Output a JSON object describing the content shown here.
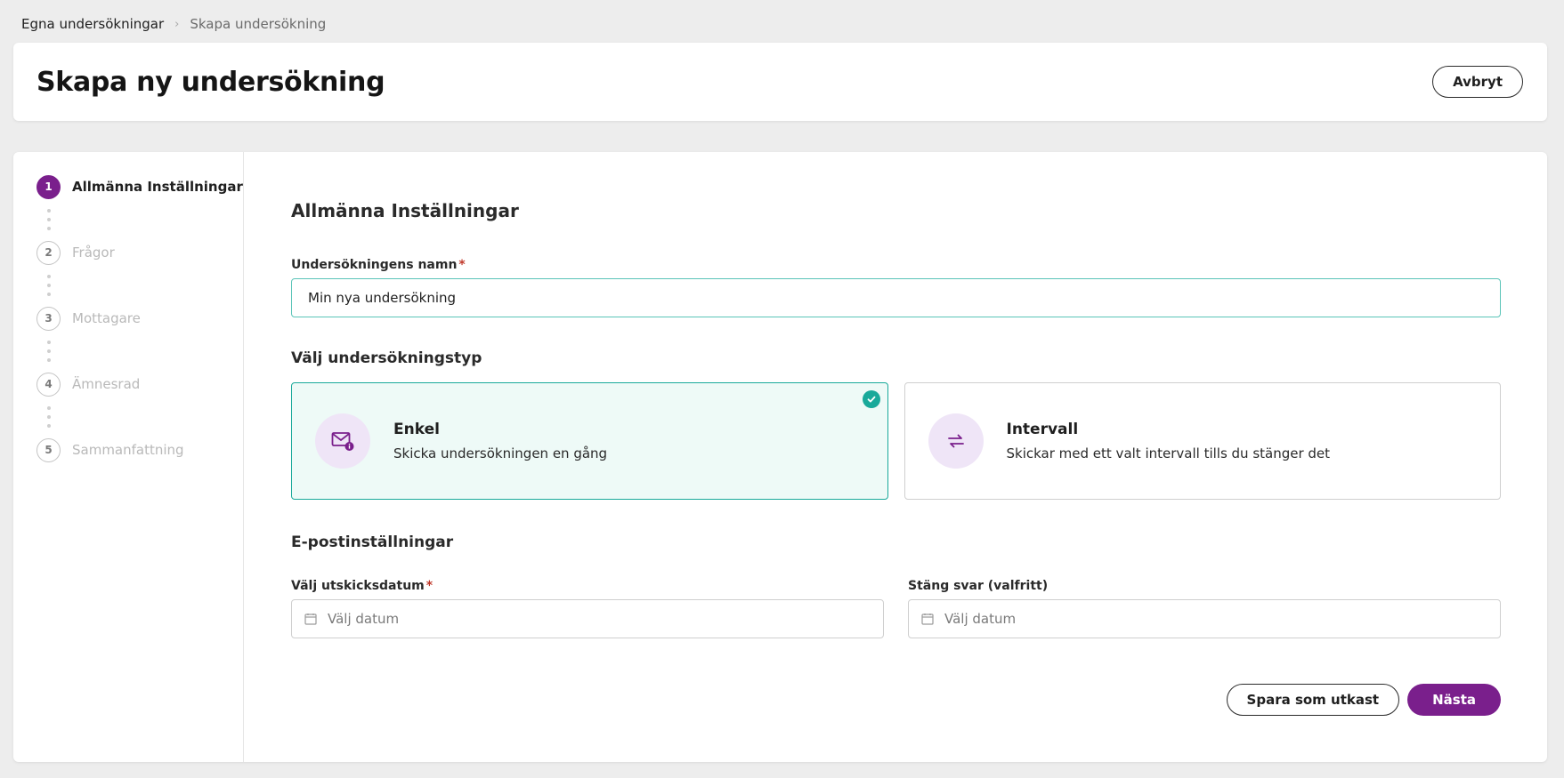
{
  "breadcrumb": {
    "parent": "Egna undersökningar",
    "separator": "›",
    "current": "Skapa undersökning"
  },
  "header": {
    "title": "Skapa ny undersökning",
    "cancel_label": "Avbryt"
  },
  "stepper": {
    "steps": [
      {
        "num": "1",
        "label": "Allmänna Inställningar",
        "active": true
      },
      {
        "num": "2",
        "label": "Frågor",
        "active": false
      },
      {
        "num": "3",
        "label": "Mottagare",
        "active": false
      },
      {
        "num": "4",
        "label": "Ämnesrad",
        "active": false
      },
      {
        "num": "5",
        "label": "Sammanfattning",
        "active": false
      }
    ]
  },
  "form": {
    "section_title": "Allmänna Inställningar",
    "name_label": "Undersökningens namn",
    "required_mark": "*",
    "name_value": "Min nya undersökning",
    "type_title": "Välj undersökningstyp",
    "types": [
      {
        "title": "Enkel",
        "desc": "Skicka undersökningen en gång",
        "icon": "mail-icon",
        "selected": true
      },
      {
        "title": "Intervall",
        "desc": "Skickar med ett valt intervall tills du stänger det",
        "icon": "repeat-icon",
        "selected": false
      }
    ],
    "email_title": "E-postinställningar",
    "send_date_label": "Välj utskicksdatum",
    "close_label": "Stäng svar (valfritt)",
    "date_placeholder": "Välj datum"
  },
  "actions": {
    "draft_label": "Spara som utkast",
    "next_label": "Nästa"
  },
  "colors": {
    "brand": "#7a1f8c",
    "teal": "#19a99a",
    "selected_bg": "#eefaf7"
  }
}
